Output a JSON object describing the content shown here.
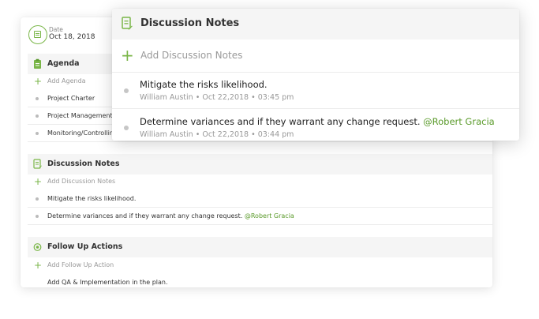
{
  "back_card": {
    "date_label": "Date",
    "date_value": "Oct 18, 2018",
    "agenda": {
      "title": "Agenda",
      "add_label": "Add Agenda",
      "items": [
        "Project Charter",
        "Project Management",
        "Monitoring/Controlling"
      ]
    },
    "discussion_notes": {
      "title": "Discussion Notes",
      "add_label": "Add Discussion Notes",
      "items": [
        {
          "text": "Mitigate the risks likelihood.",
          "mention": ""
        },
        {
          "text": "Determine variances and if they warrant any change request.",
          "mention": "@Robert Gracia"
        }
      ]
    },
    "follow_up": {
      "title": "Follow Up Actions",
      "add_label": "Add Follow Up Action",
      "items": [
        "Add QA & Implementation in the plan."
      ]
    }
  },
  "front_card": {
    "title": "Discussion Notes",
    "add_label": "Add Discussion Notes",
    "notes": [
      {
        "text": "Mitigate the risks likelihood.",
        "mention": "",
        "author": "William Austin",
        "timestamp": "Oct 22,2018 • 03:45 pm"
      },
      {
        "text": "Determine variances and if they warrant any change request.",
        "mention": "@Robert Gracia",
        "author": "William Austin",
        "timestamp": "Oct 22,2018 • 03:44 pm"
      }
    ]
  },
  "colors": {
    "accent": "#7ab648",
    "mention": "#5a9a2a"
  },
  "icons": {
    "date": "calendar-icon",
    "agenda": "clipboard-icon",
    "notes": "note-edit-icon",
    "follow_up": "target-icon",
    "add": "plus-icon"
  }
}
